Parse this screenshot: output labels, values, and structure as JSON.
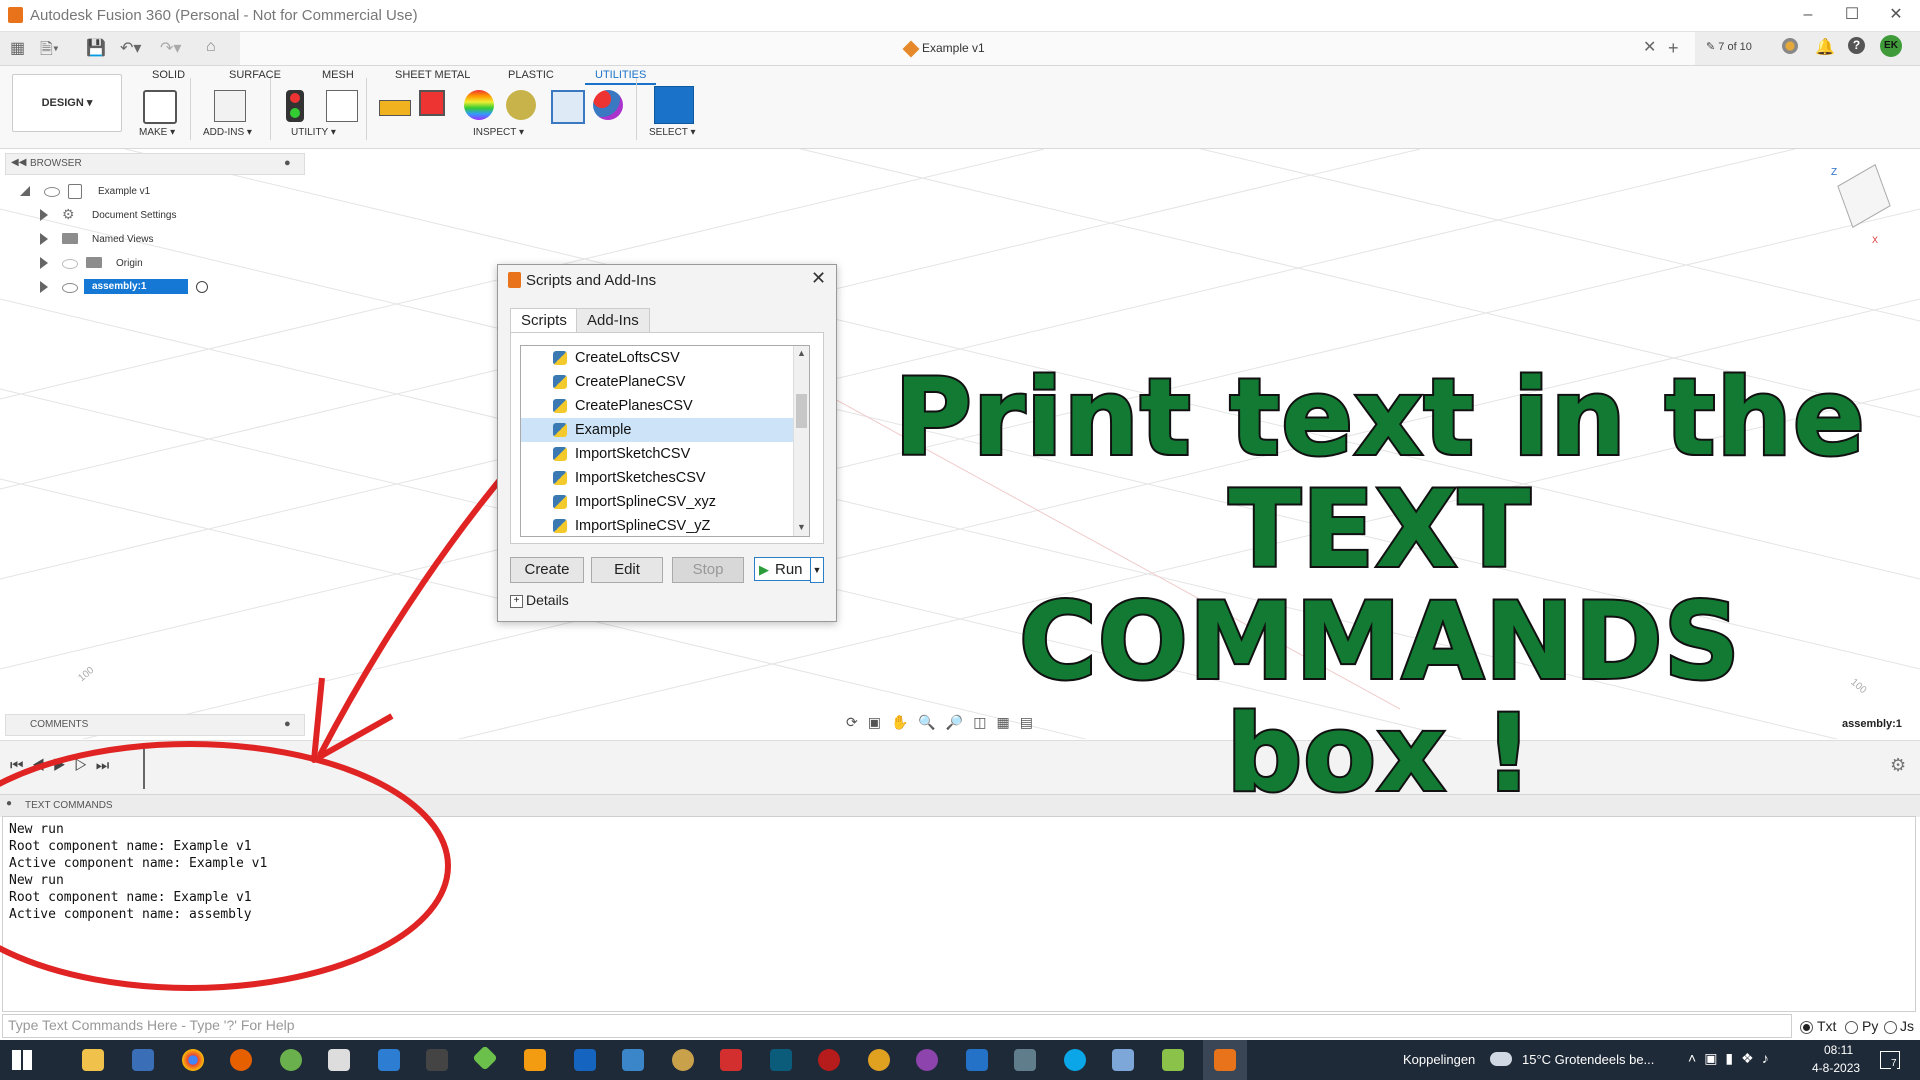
{
  "window": {
    "title": "Autodesk Fusion 360 (Personal - Not for Commercial Use)"
  },
  "doc_tab": {
    "title": "Example v1",
    "page_counter": "7 of 10",
    "user_initials": "EK"
  },
  "ribbon": {
    "workspace": "DESIGN ▾",
    "tabs": [
      "SOLID",
      "SURFACE",
      "MESH",
      "SHEET METAL",
      "PLASTIC",
      "UTILITIES"
    ],
    "active_tab": "UTILITIES",
    "groups": [
      "MAKE ▾",
      "ADD-INS ▾",
      "UTILITY ▾",
      "INSPECT ▾",
      "SELECT ▾"
    ]
  },
  "browser": {
    "header": "BROWSER",
    "items": [
      {
        "label": "Example v1"
      },
      {
        "label": "Document Settings"
      },
      {
        "label": "Named Views"
      },
      {
        "label": "Origin"
      },
      {
        "label": "assembly:1"
      }
    ]
  },
  "comments": {
    "header": "COMMENTS"
  },
  "viewport": {
    "component_label": "assembly:1",
    "axis_labels": [
      "Z",
      "X"
    ],
    "grid_numbers": [
      "100",
      "100"
    ]
  },
  "dialog": {
    "title": "Scripts and Add-Ins",
    "tabs": [
      "Scripts",
      "Add-Ins"
    ],
    "scripts": [
      "CreateLoftsCSV",
      "CreatePlaneCSV",
      "CreatePlanesCSV",
      "Example",
      "ImportSketchCSV",
      "ImportSketchesCSV",
      "ImportSplineCSV_xyz",
      "ImportSplineCSV_yZ"
    ],
    "selected": "Example",
    "buttons": {
      "create": "Create",
      "edit": "Edit",
      "stop": "Stop",
      "run": "Run"
    },
    "details": "Details"
  },
  "overlay": {
    "line1": "Print text in the",
    "line2": "TEXT COMMANDS",
    "line3": "box !",
    "color": "#127a33"
  },
  "text_commands": {
    "header": "TEXT COMMANDS",
    "lines": [
      "New run",
      "Root component name: Example v1",
      "Active component name: Example v1",
      "New run",
      "Root component name: Example v1",
      "Active component name: assembly"
    ],
    "input_placeholder": "Type Text Commands Here - Type '?' For Help",
    "modes": [
      "Txt",
      "Py",
      "Js"
    ],
    "selected_mode": "Txt"
  },
  "taskbar": {
    "links_label": "Koppelingen",
    "weather": "15°C  Grotendeels be...",
    "time": "08:11",
    "date": "4-8-2023",
    "notification_count": "7"
  }
}
